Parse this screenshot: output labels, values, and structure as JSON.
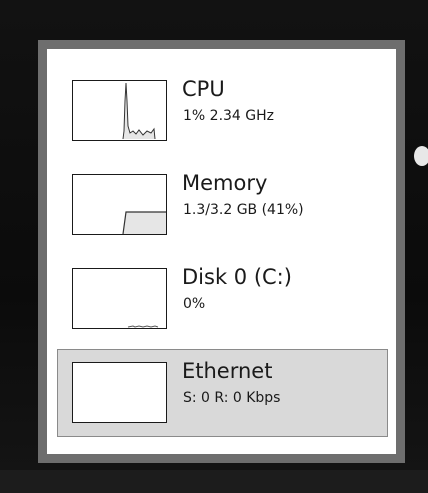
{
  "perf_list": {
    "items": [
      {
        "name": "CPU",
        "detail": "1% 2.34 GHz",
        "selected": false
      },
      {
        "name": "Memory",
        "detail": "1.3/3.2 GB (41%)",
        "selected": false,
        "usage_fraction": 0.41
      },
      {
        "name": "Disk 0 (C:)",
        "detail": "0%",
        "selected": false
      },
      {
        "name": "Ethernet",
        "detail": "S: 0 R: 0 Kbps",
        "selected": true
      }
    ]
  },
  "colors": {
    "panel": "#ffffff",
    "frame": "#6e6e6e",
    "selected_bg": "#d9d9d9",
    "graph_line": "#333333"
  }
}
